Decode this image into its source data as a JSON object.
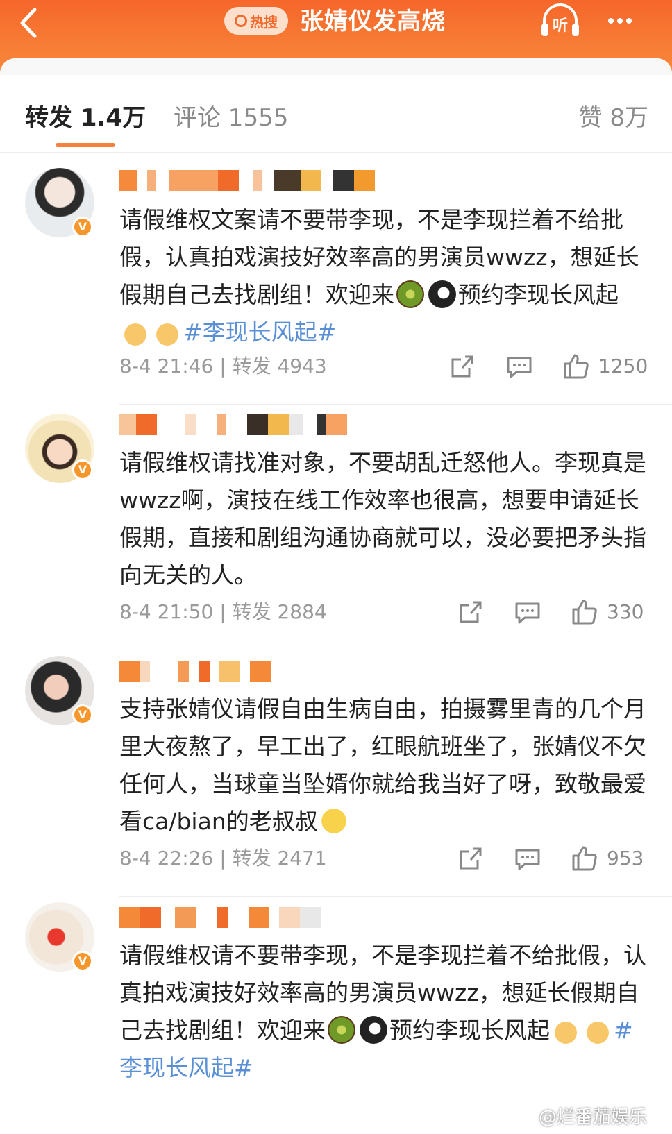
{
  "header": {
    "hot_badge": "热搜",
    "title": "张婧仪发高烧",
    "listen_label": "听",
    "accent_color": "#f6662a"
  },
  "tabs": {
    "forward": "转发 1.4万",
    "comment": "评论 1555",
    "like": "赞 8万"
  },
  "posts": [
    {
      "text_before": "请假维权文案请不要带李现，不是李现拦着不给批假，认真拍戏演技好效率高的男演员wwzz，想延长假期自己去找剧组！欢迎来",
      "text_after": "预约李现长风起",
      "hashtag": "#李现长风起#",
      "time": "8-4 21:46",
      "forward": "转发 4943",
      "likes": "1250"
    },
    {
      "text": "请假维权请找准对象，不要胡乱迁怒他人。李现真是wwzz啊，演技在线工作效率也很高，想要申请延长假期，直接和剧组沟通协商就可以，没必要把矛头指向无关的人。",
      "time": "8-4 21:50",
      "forward": "转发 2884",
      "likes": "330"
    },
    {
      "text": "支持张婧仪请假自由生病自由，拍摄雾里青的几个月里大夜熬了，早工出了，红眼航班坐了，张婧仪不欠任何人，当球童当坠婿你就给我当好了呀，致敬最爱看ca/bian的老叔叔",
      "time": "8-4 22:26",
      "forward": "转发 2471",
      "likes": "953"
    },
    {
      "text_before": "请假维权请不要带李现，不是李现拦着不给批假，认真拍戏演技好效率高的男演员wwzz，想延长假期自己去找剧组！欢迎来",
      "text_after": "预约李现长风起",
      "hashtag": "#李现长风起#"
    }
  ],
  "watermark": "@烂番茄娱乐"
}
